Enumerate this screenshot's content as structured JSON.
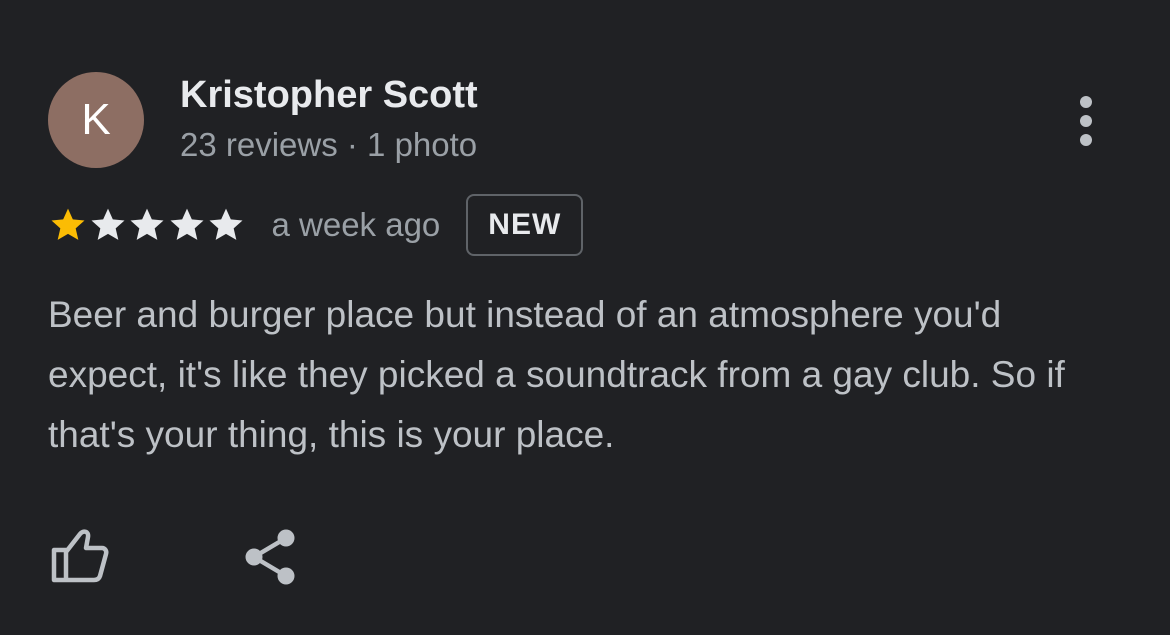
{
  "review": {
    "author": {
      "initial": "K",
      "name": "Kristopher Scott",
      "meta": "23 reviews · 1 photo"
    },
    "rating": 1,
    "max_rating": 5,
    "date": "a week ago",
    "badge": "NEW",
    "text": "Beer and burger place but instead of an atmosphere you'd expect, it's like they picked a soundtrack from a gay club. So if that's your thing, this is your place."
  },
  "actions": {
    "more_icon": "more-vert-icon",
    "like_icon": "thumb-up-icon",
    "share_icon": "share-icon"
  },
  "colors": {
    "background": "#202124",
    "avatar": "#8d6e63",
    "star_filled": "#fbbc04",
    "star_empty": "#e8eaed",
    "primary_text": "#e8eaed",
    "secondary_text": "#9aa0a6",
    "body_text": "#bdc1c6",
    "icon": "#bdc1c6"
  }
}
